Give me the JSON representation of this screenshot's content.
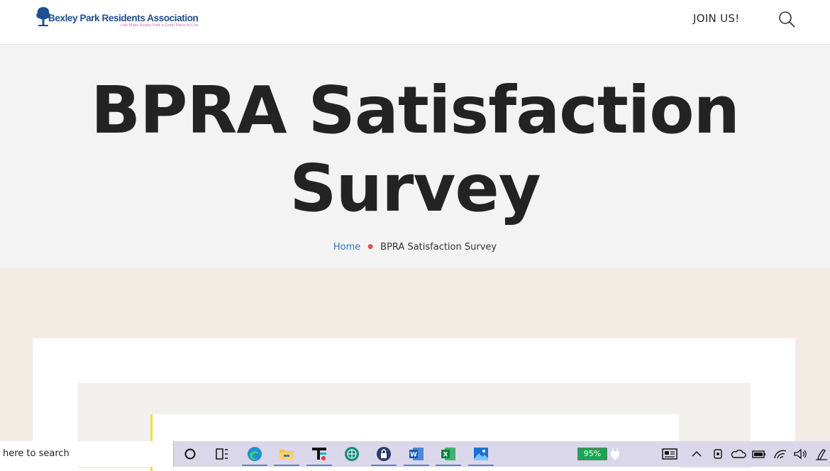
{
  "header": {
    "logo_title": "Bexley Park Residents Association",
    "logo_tagline": "Lets Make Bexley Park a Great Place to Live",
    "join_label": "JOIN US!",
    "search_icon": "search-icon"
  },
  "hero": {
    "title_line1": "BPRA Satisfaction",
    "title_line2": "Survey",
    "breadcrumb": {
      "home": "Home",
      "current": "BPRA Satisfaction Survey"
    }
  },
  "taskbar": {
    "search_text": "here to search",
    "battery_percent": "95%",
    "icons": [
      "cortana-icon",
      "task-view-icon",
      "edge-icon",
      "file-explorer-icon",
      "app-icon",
      "globe-app-icon",
      "lock-app-icon",
      "word-icon",
      "excel-icon",
      "photos-icon",
      "news-icon",
      "chevron-up-icon",
      "meet-icon",
      "onedrive-icon",
      "battery-icon",
      "wifi-icon",
      "volume-icon",
      "pen-icon"
    ]
  },
  "colors": {
    "logo_blue": "#1d4f91",
    "breadcrumb_link": "#2f73c2",
    "breadcrumb_sep": "#d9534f",
    "hero_bg": "#f3f3f3",
    "content_bg": "#f3ece4",
    "battery_green": "#1aa552"
  }
}
